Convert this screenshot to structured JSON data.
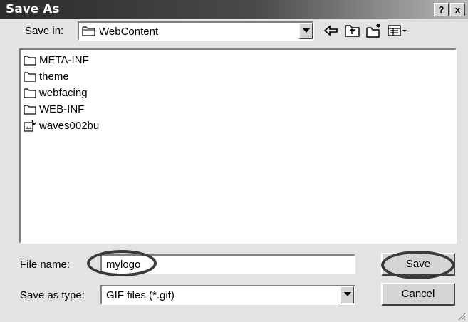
{
  "window": {
    "title": "Save As",
    "help_button": "?",
    "close_button": "x"
  },
  "toolbar": {
    "save_in_label": "Save in:",
    "save_in_value": "WebContent",
    "icons": [
      "back-icon",
      "up-folder-icon",
      "new-folder-icon",
      "view-menu-icon"
    ]
  },
  "files": [
    {
      "name": "META-INF",
      "icon": "folder-icon"
    },
    {
      "name": "theme",
      "icon": "folder-icon"
    },
    {
      "name": "webfacing",
      "icon": "folder-icon"
    },
    {
      "name": "WEB-INF",
      "icon": "folder-icon"
    },
    {
      "name": "waves002bu",
      "icon": "image-file-icon"
    }
  ],
  "form": {
    "file_name_label": "File name:",
    "file_name_value": "mylogo",
    "save_as_type_label": "Save as type:",
    "save_as_type_value": "GIF files (*.gif)"
  },
  "buttons": {
    "save_label": "Save",
    "cancel_label": "Cancel"
  }
}
